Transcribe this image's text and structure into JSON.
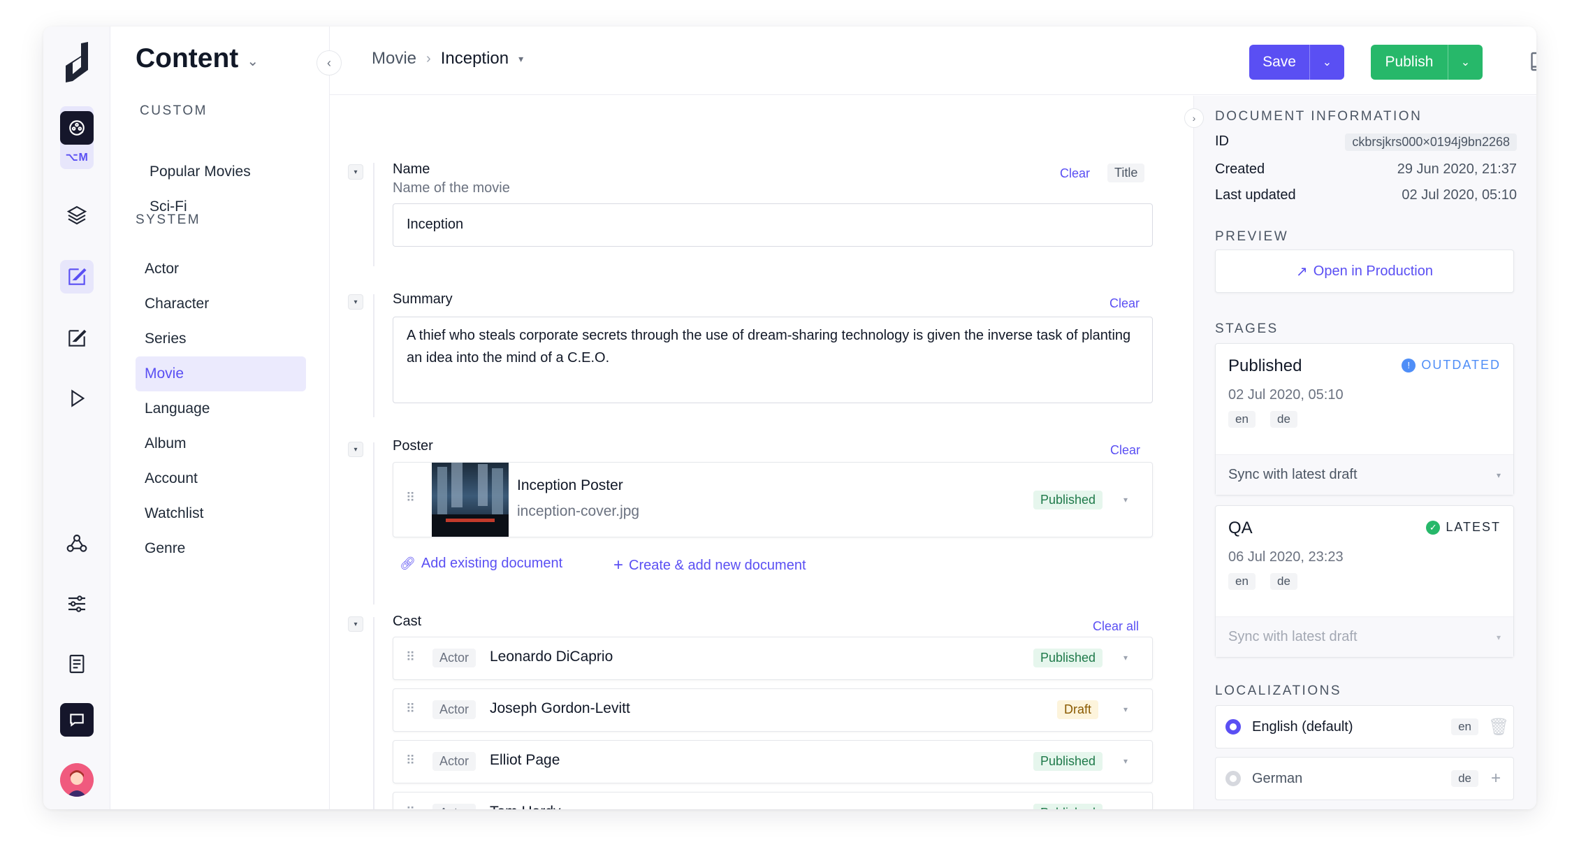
{
  "nav": {
    "title": "Content",
    "project_badge": "⌥M",
    "sections": {
      "custom": "CUSTOM",
      "system": "SYSTEM"
    },
    "custom_items": [
      "Popular Movies",
      "Sci-Fi"
    ],
    "system_items": [
      "Actor",
      "Character",
      "Series",
      "Movie",
      "Language",
      "Album",
      "Account",
      "Watchlist",
      "Genre"
    ],
    "selected": "Movie"
  },
  "breadcrumb": {
    "model": "Movie",
    "entry": "Inception"
  },
  "toolbar": {
    "save_label": "Save",
    "publish_label": "Publish"
  },
  "fields": {
    "name": {
      "label": "Name",
      "hint": "Name of the movie",
      "clear": "Clear",
      "tag": "Title",
      "value": "Inception"
    },
    "summary": {
      "label": "Summary",
      "clear": "Clear",
      "value": "A thief who steals corporate secrets through the use of dream-sharing technology is given the inverse task of planting an idea into the mind of a C.E.O."
    },
    "poster": {
      "label": "Poster",
      "clear": "Clear",
      "title": "Inception Poster",
      "file": "inception-cover.jpg",
      "status": "Published",
      "add_existing": "Add existing document",
      "create_new": "Create & add new document"
    },
    "cast": {
      "label": "Cast",
      "clear": "Clear all",
      "rows": [
        {
          "type": "Actor",
          "name": "Leonardo DiCaprio",
          "status": "Published"
        },
        {
          "type": "Actor",
          "name": "Joseph Gordon-Levitt",
          "status": "Draft"
        },
        {
          "type": "Actor",
          "name": "Elliot Page",
          "status": "Published"
        },
        {
          "type": "Actor",
          "name": "Tom Hardy",
          "status": "Published"
        }
      ]
    }
  },
  "sidebar": {
    "doc_info_title": "DOCUMENT INFORMATION",
    "id_label": "ID",
    "id_value": "ckbrsjkrs000×0194j9bn2268",
    "created_label": "Created",
    "created_value": "29 Jun 2020, 21:37",
    "updated_label": "Last updated",
    "updated_value": "02 Jul 2020, 05:10",
    "preview_title": "PREVIEW",
    "preview_link": "Open in Production",
    "stages_title": "STAGES",
    "stages": [
      {
        "name": "Published",
        "badge": "OUTDATED",
        "date": "02 Jul 2020, 05:10",
        "locales": [
          "en",
          "de"
        ],
        "sync": "Sync with latest draft"
      },
      {
        "name": "QA",
        "badge": "LATEST",
        "date": "06 Jul 2020, 23:23",
        "locales": [
          "en",
          "de"
        ],
        "sync": "Sync with latest draft"
      }
    ],
    "localizations_title": "LOCALIZATIONS",
    "localizations": [
      {
        "name": "English (default)",
        "code": "en"
      },
      {
        "name": "German",
        "code": "de"
      }
    ]
  },
  "colors": {
    "accent": "#5a4ff3",
    "publish": "#27b86a",
    "outdated": "#4f8ef7",
    "latest": "#27b86a"
  }
}
